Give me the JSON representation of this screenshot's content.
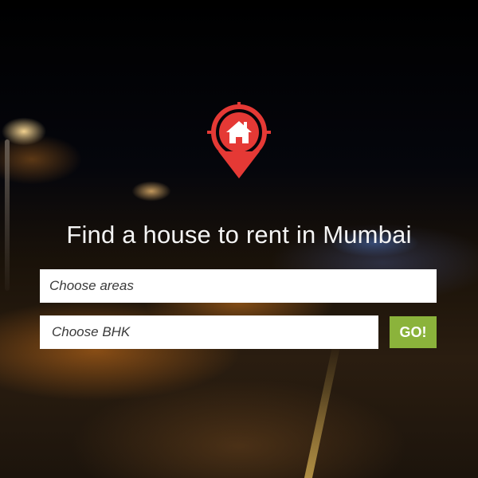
{
  "hero": {
    "headline": "Find a house to rent in Mumbai",
    "logo_icon": "house-location-pin-icon",
    "accent_color": "#e53935"
  },
  "search": {
    "areas_placeholder": "Choose areas",
    "bhk_placeholder": "Choose BHK",
    "go_label": "GO!",
    "go_color": "#8bb33b"
  }
}
